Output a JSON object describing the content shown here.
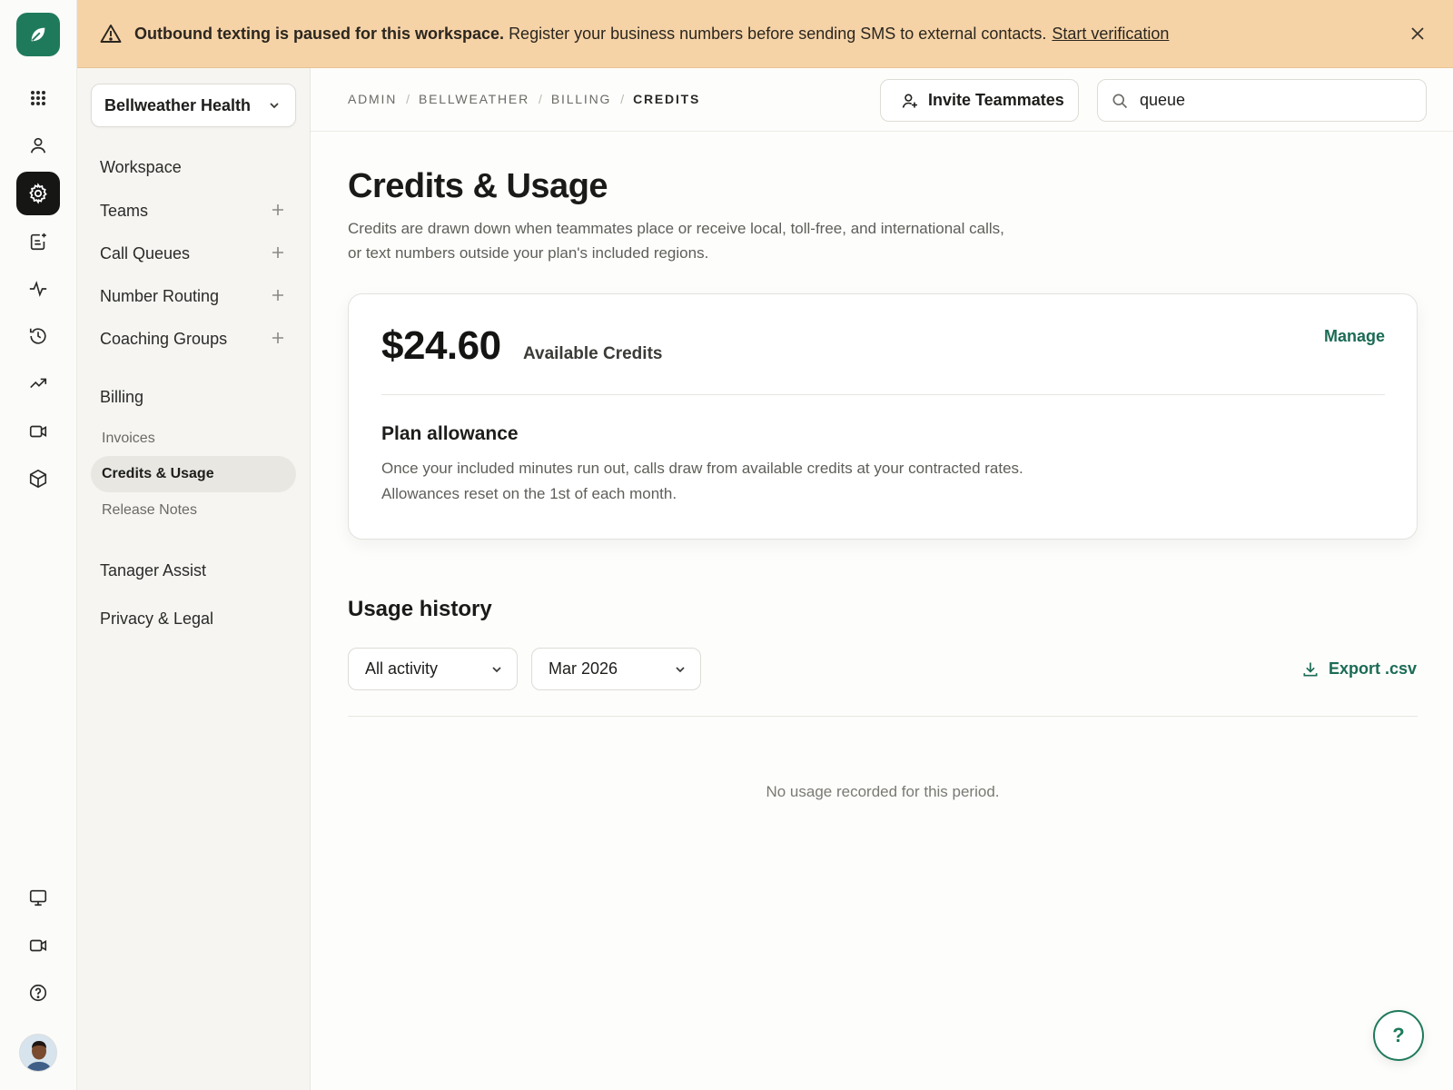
{
  "banner": {
    "icon": "warning-triangle-icon",
    "bold_text": "Outbound texting is paused for this workspace.",
    "text": "Register your business numbers before sending SMS to external contacts.",
    "link": "Start verification",
    "close_icon": "close-icon"
  },
  "rail": {
    "logo_icon": "leaf-logo-icon",
    "items": [
      {
        "icon": "apps-grid-icon"
      },
      {
        "icon": "person-icon"
      },
      {
        "icon": "gear-icon",
        "active": true
      },
      {
        "icon": "note-edit-icon"
      },
      {
        "icon": "activity-pulse-icon"
      },
      {
        "icon": "history-icon"
      },
      {
        "icon": "trend-up-icon"
      },
      {
        "icon": "video-camera-icon"
      },
      {
        "icon": "box-icon"
      }
    ],
    "bottom_items": [
      {
        "icon": "monitor-icon"
      },
      {
        "icon": "video-camera-icon"
      },
      {
        "icon": "help-circle-icon"
      }
    ],
    "avatar": "user-avatar"
  },
  "sidebar": {
    "workspace": "Bellweather Health",
    "items": [
      {
        "label": "Workspace"
      },
      {
        "label": "Teams",
        "addable": true
      },
      {
        "label": "Call Queues",
        "addable": true
      },
      {
        "label": "Number Routing",
        "addable": true
      },
      {
        "label": "Coaching Groups",
        "addable": true
      }
    ],
    "billing": {
      "label": "Billing",
      "children": [
        "Invoices",
        "Credits & Usage",
        "Release Notes"
      ],
      "active": "Credits & Usage"
    },
    "footer_items": [
      "Tanager Assist",
      "Privacy & Legal"
    ]
  },
  "topbar": {
    "breadcrumb": [
      "ADMIN",
      "BELLWEATHER",
      "BILLING",
      "CREDITS"
    ],
    "invite_label": "Invite Teammates",
    "search_value": "queue"
  },
  "main": {
    "title": "Credits & Usage",
    "description": "Credits are drawn down when teammates place or receive local, toll-free, and international calls, or text numbers outside your plan's included regions.",
    "credits": {
      "amount": "$24.60",
      "label": "Available Credits",
      "manage": "Manage"
    },
    "allowance": {
      "title": "Plan allowance",
      "text": "Once your included minutes run out, calls draw from available credits at your contracted rates. Allowances reset on the 1st of each month."
    },
    "usage": {
      "title": "Usage history",
      "filter_activity": "All activity",
      "filter_period": "Mar 2026",
      "export": "Export .csv",
      "empty": "No usage recorded for this period."
    },
    "help_fab": "?"
  },
  "colors": {
    "accent": "#1f7a5c",
    "banner_bg": "#f6d3a7",
    "link_green": "#1b6b55"
  }
}
